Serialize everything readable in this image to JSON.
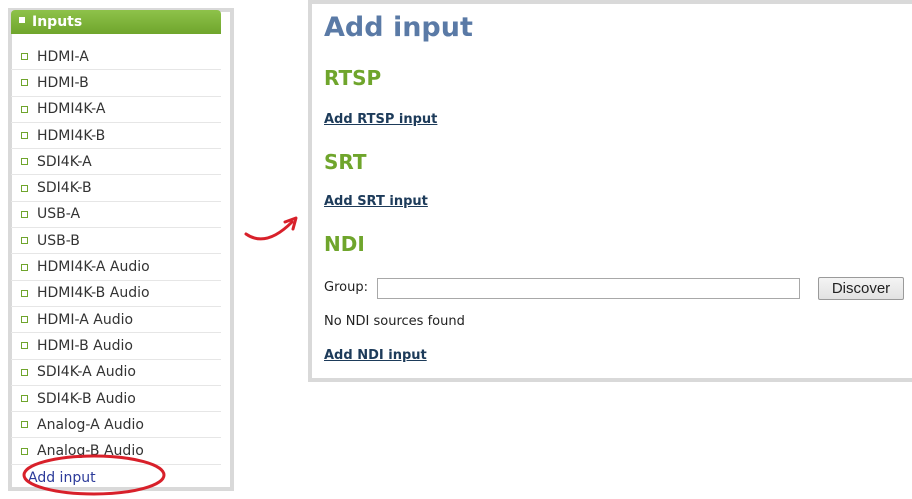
{
  "sidebar": {
    "header": "Inputs",
    "items": [
      {
        "label": "HDMI-A"
      },
      {
        "label": "HDMI-B"
      },
      {
        "label": "HDMI4K-A"
      },
      {
        "label": "HDMI4K-B"
      },
      {
        "label": "SDI4K-A"
      },
      {
        "label": "SDI4K-B"
      },
      {
        "label": "USB-A"
      },
      {
        "label": "USB-B"
      },
      {
        "label": "HDMI4K-A Audio"
      },
      {
        "label": "HDMI4K-B Audio"
      },
      {
        "label": "HDMI-A Audio"
      },
      {
        "label": "HDMI-B Audio"
      },
      {
        "label": "SDI4K-A Audio"
      },
      {
        "label": "SDI4K-B Audio"
      },
      {
        "label": "Analog-A Audio"
      },
      {
        "label": "Analog-B Audio"
      }
    ],
    "add_input": "Add input"
  },
  "main": {
    "title": "Add input",
    "rtsp": {
      "heading": "RTSP",
      "link": "Add RTSP input"
    },
    "srt": {
      "heading": "SRT",
      "link": "Add SRT input"
    },
    "ndi": {
      "heading": "NDI",
      "group_label": "Group:",
      "group_value": "",
      "discover_button": "Discover",
      "status": "No NDI sources found",
      "link": "Add NDI input"
    }
  },
  "colors": {
    "accent_green": "#6fa52c",
    "title_blue": "#5a7aa6",
    "link_dark": "#1d3b5a",
    "annotation_red": "#d8202a"
  }
}
